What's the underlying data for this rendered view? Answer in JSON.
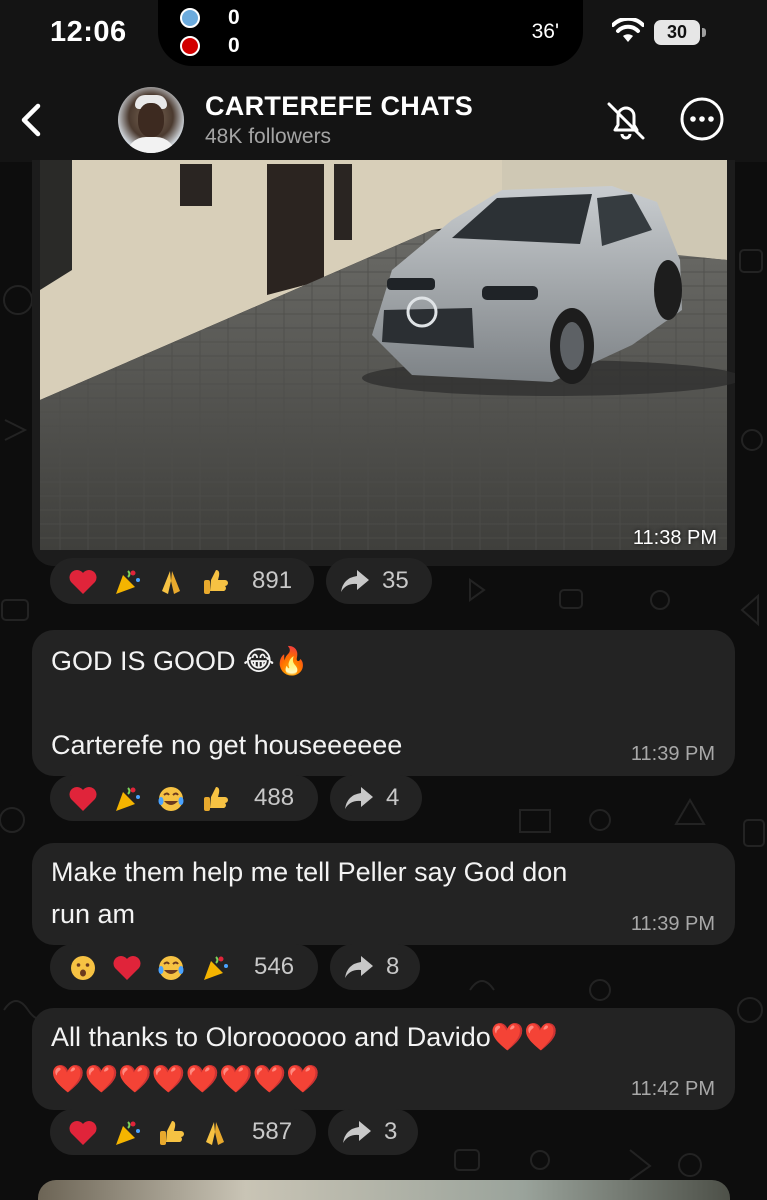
{
  "status_bar": {
    "time": "12:06",
    "live_score": {
      "home_score": "0",
      "away_score": "0",
      "minute": "36'"
    },
    "battery": "30"
  },
  "header": {
    "channel_name": "CARTEREFE CHATS",
    "followers": "48K followers"
  },
  "messages": [
    {
      "type": "photo",
      "time": "11:38 PM",
      "reactions": [
        "heart",
        "party-popper",
        "folded-hands",
        "thumbs-up"
      ],
      "reaction_count": "891",
      "forwards": "35"
    },
    {
      "type": "text",
      "text": "GOD IS GOOD 😂🔥\n\nCarterefe no get houseeeeee",
      "time": "11:39 PM",
      "reactions": [
        "heart",
        "party-popper",
        "tears-of-joy",
        "thumbs-up"
      ],
      "reaction_count": "488",
      "forwards": "4"
    },
    {
      "type": "text",
      "text": "Make them help me tell Peller say God don\nrun am",
      "time": "11:39 PM",
      "reactions": [
        "hushed-face",
        "heart",
        "tears-of-joy",
        "party-popper"
      ],
      "reaction_count": "546",
      "forwards": "8"
    },
    {
      "type": "text",
      "text": "All thanks to Oloroooooo and Davido❤️❤️\n❤️❤️❤️❤️❤️❤️❤️❤️",
      "time": "11:42 PM",
      "reactions": [
        "heart",
        "party-popper",
        "thumbs-up",
        "folded-hands"
      ],
      "reaction_count": "587",
      "forwards": "3"
    }
  ],
  "colors": {
    "background": "#0d0d0d",
    "bubble": "#232323",
    "header": "#141414",
    "heart": "#e0243a"
  }
}
